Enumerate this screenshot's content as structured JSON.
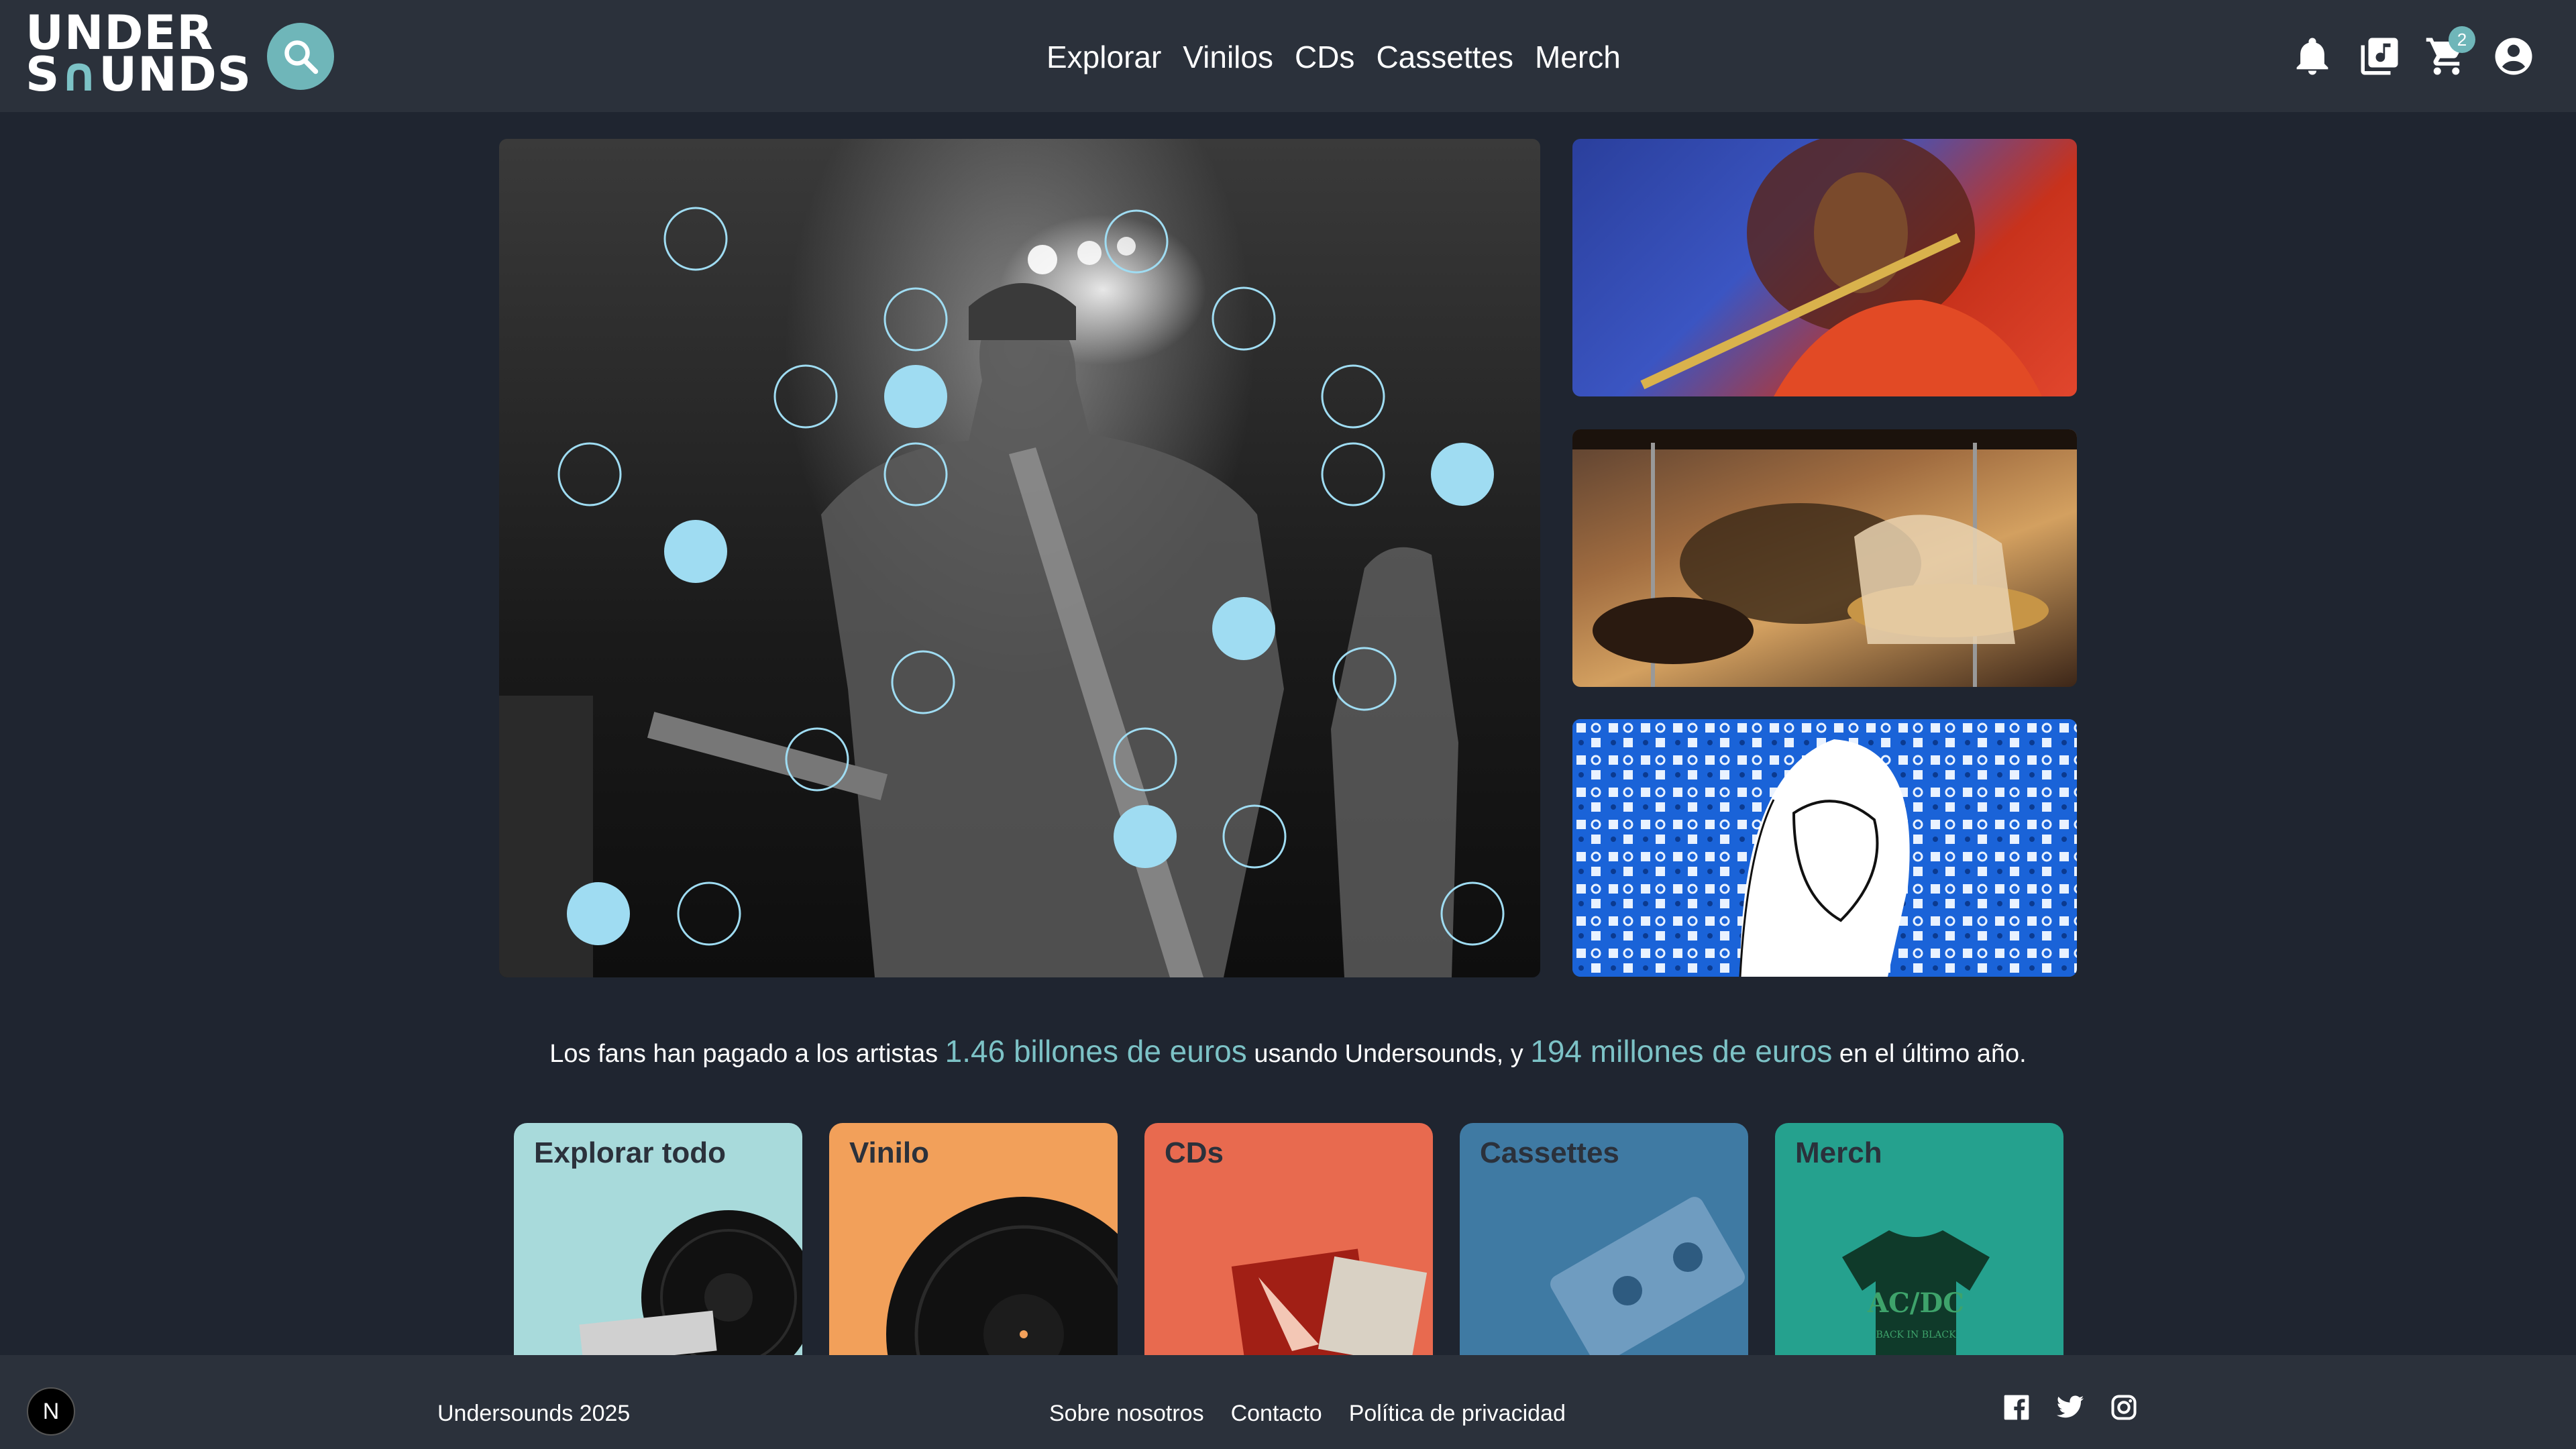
{
  "brand": {
    "logo_line1": "UNDER",
    "logo_line2_a": "S",
    "logo_line2_b": "UNDS",
    "accent": "#7cc2c6"
  },
  "header": {
    "search_icon": "search-icon",
    "nav": [
      "Explorar",
      "Vinilos",
      "CDs",
      "Cassettes",
      "Merch"
    ],
    "cart_count": "2",
    "icons": [
      "bell-icon",
      "music-library-icon",
      "cart-icon",
      "account-icon"
    ]
  },
  "stats": {
    "prefix": "Los fans han pagado a los artistas ",
    "amount1": "1.46 billones de euros",
    "middle": " usando Undersounds, y ",
    "amount2": "194 millones de euros",
    "suffix": " en el último año."
  },
  "categories": [
    {
      "label": "Explorar todo",
      "color": "#a8dadb"
    },
    {
      "label": "Vinilo",
      "color": "#f2a05a"
    },
    {
      "label": "CDs",
      "color": "#e86a4f"
    },
    {
      "label": "Cassettes",
      "color": "#3f7aa3"
    },
    {
      "label": "Merch",
      "color": "#25a18e"
    }
  ],
  "footer": {
    "badge": "N",
    "copyright": "Undersounds 2025",
    "links": [
      "Sobre nosotros",
      "Contacto",
      "Política de privacidad"
    ],
    "social": [
      "facebook-icon",
      "twitter-icon",
      "instagram-icon"
    ]
  }
}
